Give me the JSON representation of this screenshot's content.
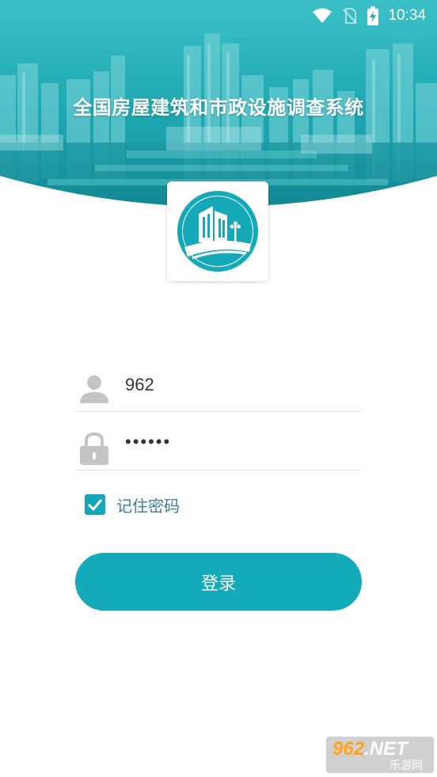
{
  "status_bar": {
    "time": "10:34",
    "icons": [
      "wifi-icon",
      "no-sim-icon",
      "battery-charging-icon"
    ]
  },
  "header": {
    "title": "全国房屋建筑和市政设施调查系统",
    "background": "city-skyline-photo",
    "accent_color": "#12a6b6"
  },
  "logo": {
    "icon": "building-emblem-icon",
    "color": "#14a8b8"
  },
  "form": {
    "username": {
      "icon": "user-icon",
      "value": "962"
    },
    "password": {
      "icon": "lock-icon",
      "value": "••••••"
    },
    "remember": {
      "label": "记住密码",
      "checked": true
    }
  },
  "login_button": {
    "label": "登录",
    "color": "#13aab9"
  },
  "watermark": {
    "brand": "962.NET",
    "brand_num": "962",
    "brand_suffix": ".NET",
    "caption": "乐游网"
  }
}
